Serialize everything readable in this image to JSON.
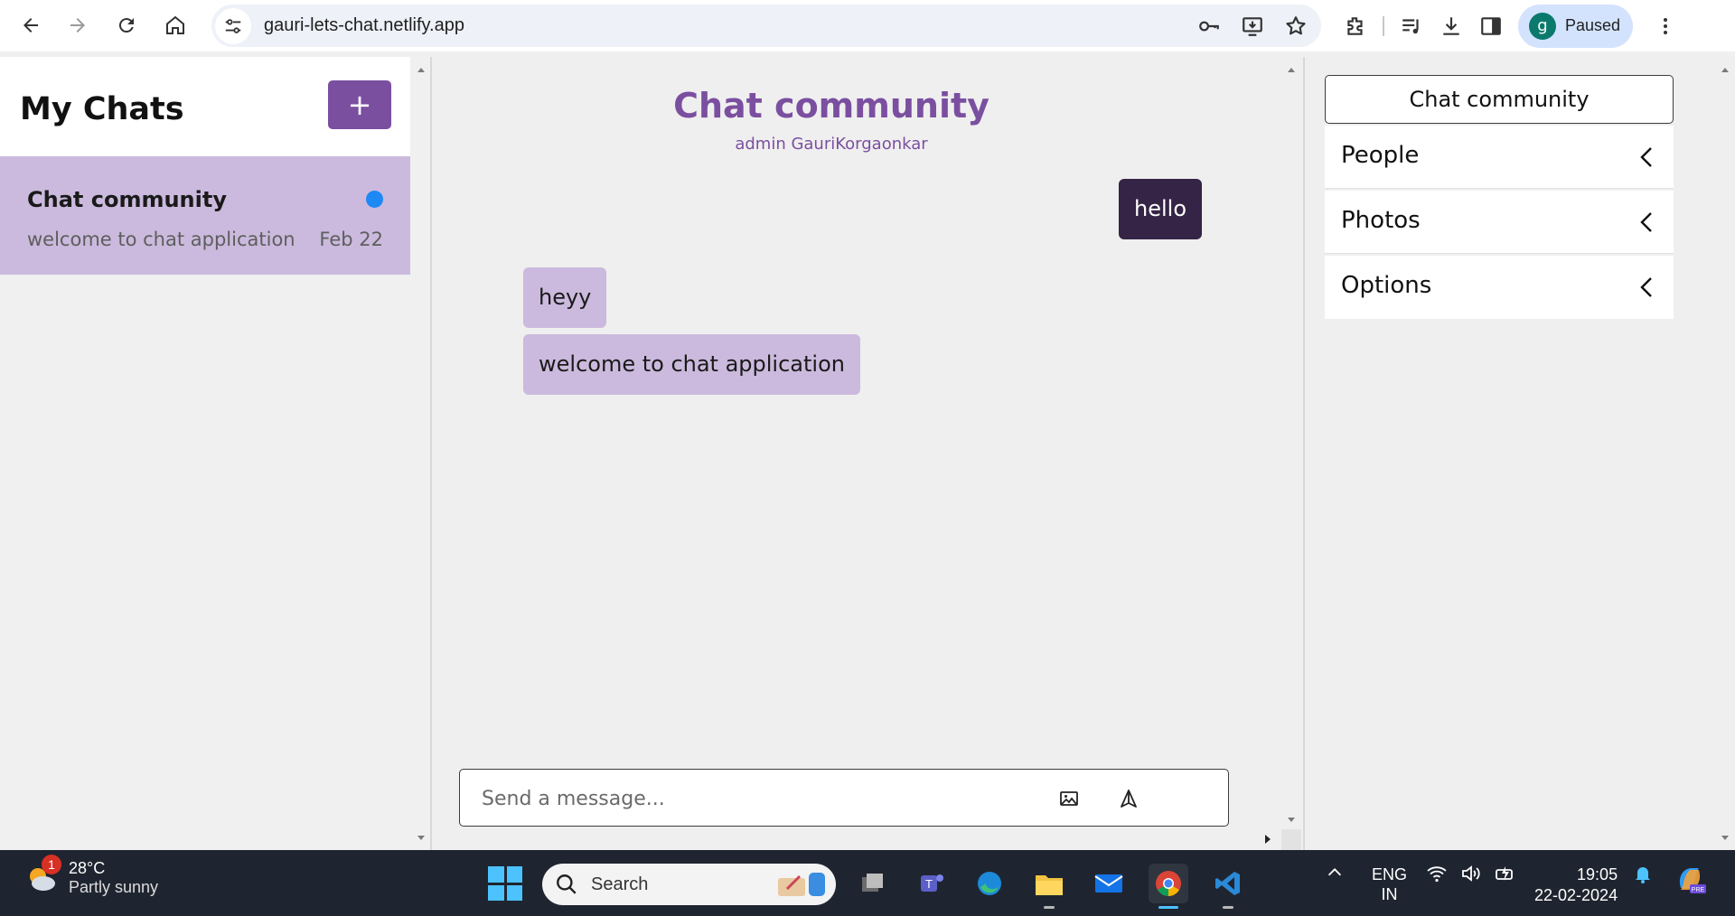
{
  "browser": {
    "url": "gauri-lets-chat.netlify.app",
    "profile_initial": "g",
    "profile_status": "Paused"
  },
  "sidebar": {
    "title": "My Chats",
    "new_chat_label": "+",
    "chats": [
      {
        "name": "Chat community",
        "preview": "welcome to chat application",
        "date": "Feb 22",
        "unread_color": "#1e88f5"
      }
    ]
  },
  "chat": {
    "title": "Chat community",
    "subtitle": "admin GauriKorgaonkar",
    "messages": [
      {
        "text": "hello",
        "from": "me"
      },
      {
        "text": "heyy",
        "from": "other"
      },
      {
        "text": "welcome to chat application",
        "from": "other"
      }
    ],
    "composer_placeholder": "Send a message..."
  },
  "details": {
    "title": "Chat community",
    "sections": [
      "People",
      "Photos",
      "Options"
    ]
  },
  "taskbar": {
    "temperature": "28°C",
    "weather": "Partly sunny",
    "weather_badge": "1",
    "search_label": "Search",
    "lang_line1": "ENG",
    "lang_line2": "IN",
    "time": "19:05",
    "date": "22-02-2024"
  },
  "colors": {
    "accent": "#7b4fa0",
    "own_bubble": "#352445",
    "other_bubble": "#cbbadd",
    "selected_chat": "#cbbadd"
  }
}
